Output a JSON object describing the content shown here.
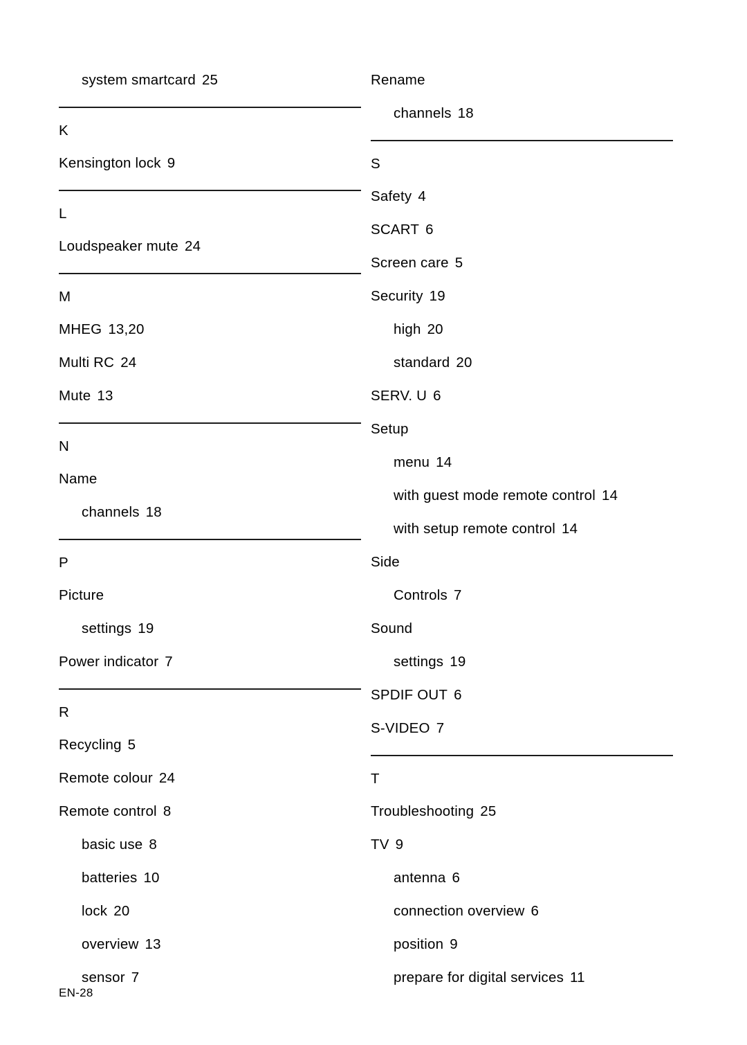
{
  "page": {
    "footer": "EN-28",
    "rule_color": "#1b1b1b"
  },
  "columns": [
    {
      "name": "left-column",
      "blocks": [
        {
          "type": "entries",
          "entries": [
            {
              "term": "system smartcard",
              "pages": "25",
              "level": "sub"
            }
          ]
        },
        {
          "type": "rule"
        },
        {
          "type": "entries",
          "entries": [
            {
              "term": "K",
              "pages": "",
              "level": "letter"
            },
            {
              "term": "Kensington lock",
              "pages": "9",
              "level": "main"
            }
          ]
        },
        {
          "type": "rule"
        },
        {
          "type": "entries",
          "entries": [
            {
              "term": "L",
              "pages": "",
              "level": "letter"
            },
            {
              "term": "Loudspeaker mute",
              "pages": "24",
              "level": "main"
            }
          ]
        },
        {
          "type": "rule"
        },
        {
          "type": "entries",
          "entries": [
            {
              "term": "M",
              "pages": "",
              "level": "letter"
            },
            {
              "term": "MHEG",
              "pages": "13,20",
              "level": "main"
            },
            {
              "term": "Multi RC",
              "pages": "24",
              "level": "main"
            },
            {
              "term": "Mute",
              "pages": "13",
              "level": "main"
            }
          ]
        },
        {
          "type": "rule"
        },
        {
          "type": "entries",
          "entries": [
            {
              "term": "N",
              "pages": "",
              "level": "letter"
            },
            {
              "term": "Name",
              "pages": "",
              "level": "main"
            },
            {
              "term": "channels",
              "pages": "18",
              "level": "sub"
            }
          ]
        },
        {
          "type": "rule"
        },
        {
          "type": "entries",
          "entries": [
            {
              "term": "P",
              "pages": "",
              "level": "letter"
            },
            {
              "term": "Picture",
              "pages": "",
              "level": "main"
            },
            {
              "term": "settings",
              "pages": "19",
              "level": "sub"
            },
            {
              "term": "Power indicator",
              "pages": "7",
              "level": "main"
            }
          ]
        },
        {
          "type": "rule"
        },
        {
          "type": "entries",
          "entries": [
            {
              "term": "R",
              "pages": "",
              "level": "letter"
            },
            {
              "term": "Recycling",
              "pages": "5",
              "level": "main"
            },
            {
              "term": "Remote colour",
              "pages": "24",
              "level": "main"
            },
            {
              "term": "Remote control",
              "pages": "8",
              "level": "main"
            },
            {
              "term": "basic use",
              "pages": "8",
              "level": "sub"
            },
            {
              "term": "batteries",
              "pages": "10",
              "level": "sub"
            },
            {
              "term": "lock",
              "pages": "20",
              "level": "sub"
            },
            {
              "term": "overview",
              "pages": "13",
              "level": "sub"
            },
            {
              "term": "sensor",
              "pages": "7",
              "level": "sub"
            }
          ]
        }
      ]
    },
    {
      "name": "right-column",
      "blocks": [
        {
          "type": "entries",
          "entries": [
            {
              "term": "Rename",
              "pages": "",
              "level": "main"
            },
            {
              "term": "channels",
              "pages": "18",
              "level": "sub"
            }
          ]
        },
        {
          "type": "rule"
        },
        {
          "type": "entries",
          "entries": [
            {
              "term": "S",
              "pages": "",
              "level": "letter"
            },
            {
              "term": "Safety",
              "pages": "4",
              "level": "main"
            },
            {
              "term": "SCART",
              "pages": "6",
              "level": "main"
            },
            {
              "term": "Screen care",
              "pages": "5",
              "level": "main"
            },
            {
              "term": "Security",
              "pages": "19",
              "level": "main"
            },
            {
              "term": "high",
              "pages": "20",
              "level": "sub"
            },
            {
              "term": "standard",
              "pages": "20",
              "level": "sub"
            },
            {
              "term": "SERV. U",
              "pages": "6",
              "level": "main"
            },
            {
              "term": "Setup",
              "pages": "",
              "level": "main"
            },
            {
              "term": "menu",
              "pages": "14",
              "level": "sub"
            },
            {
              "term": "with guest mode remote control",
              "pages": "14",
              "level": "sub"
            },
            {
              "term": "with setup remote control",
              "pages": "14",
              "level": "sub"
            },
            {
              "term": "Side",
              "pages": "",
              "level": "main"
            },
            {
              "term": "Controls",
              "pages": "7",
              "level": "sub"
            },
            {
              "term": "Sound",
              "pages": "",
              "level": "main"
            },
            {
              "term": "settings",
              "pages": "19",
              "level": "sub"
            },
            {
              "term": "SPDIF OUT",
              "pages": "6",
              "level": "main"
            },
            {
              "term": "S-VIDEO",
              "pages": "7",
              "level": "main"
            }
          ]
        },
        {
          "type": "rule"
        },
        {
          "type": "entries",
          "entries": [
            {
              "term": "T",
              "pages": "",
              "level": "letter"
            },
            {
              "term": "Troubleshooting",
              "pages": "25",
              "level": "main"
            },
            {
              "term": "TV",
              "pages": "9",
              "level": "main"
            },
            {
              "term": "antenna",
              "pages": "6",
              "level": "sub"
            },
            {
              "term": "connection overview",
              "pages": "6",
              "level": "sub"
            },
            {
              "term": "position",
              "pages": "9",
              "level": "sub"
            },
            {
              "term": "prepare for digital services",
              "pages": "11",
              "level": "sub"
            }
          ]
        }
      ]
    }
  ]
}
